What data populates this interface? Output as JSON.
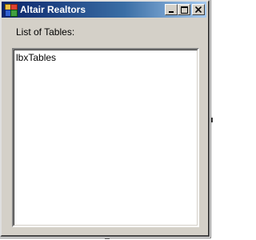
{
  "window": {
    "title": "Altair Realtors",
    "app_icon": "windows-form-icon",
    "buttons": {
      "minimize": "minimize-icon",
      "maximize": "maximize-icon",
      "close": "close-icon"
    }
  },
  "form": {
    "label": "List of Tables:",
    "listbox": {
      "items": [
        "lbxTables"
      ]
    }
  },
  "colors": {
    "titlebar_start": "#0a246a",
    "titlebar_end": "#a6caf0",
    "form_background": "#d4d0c8"
  }
}
